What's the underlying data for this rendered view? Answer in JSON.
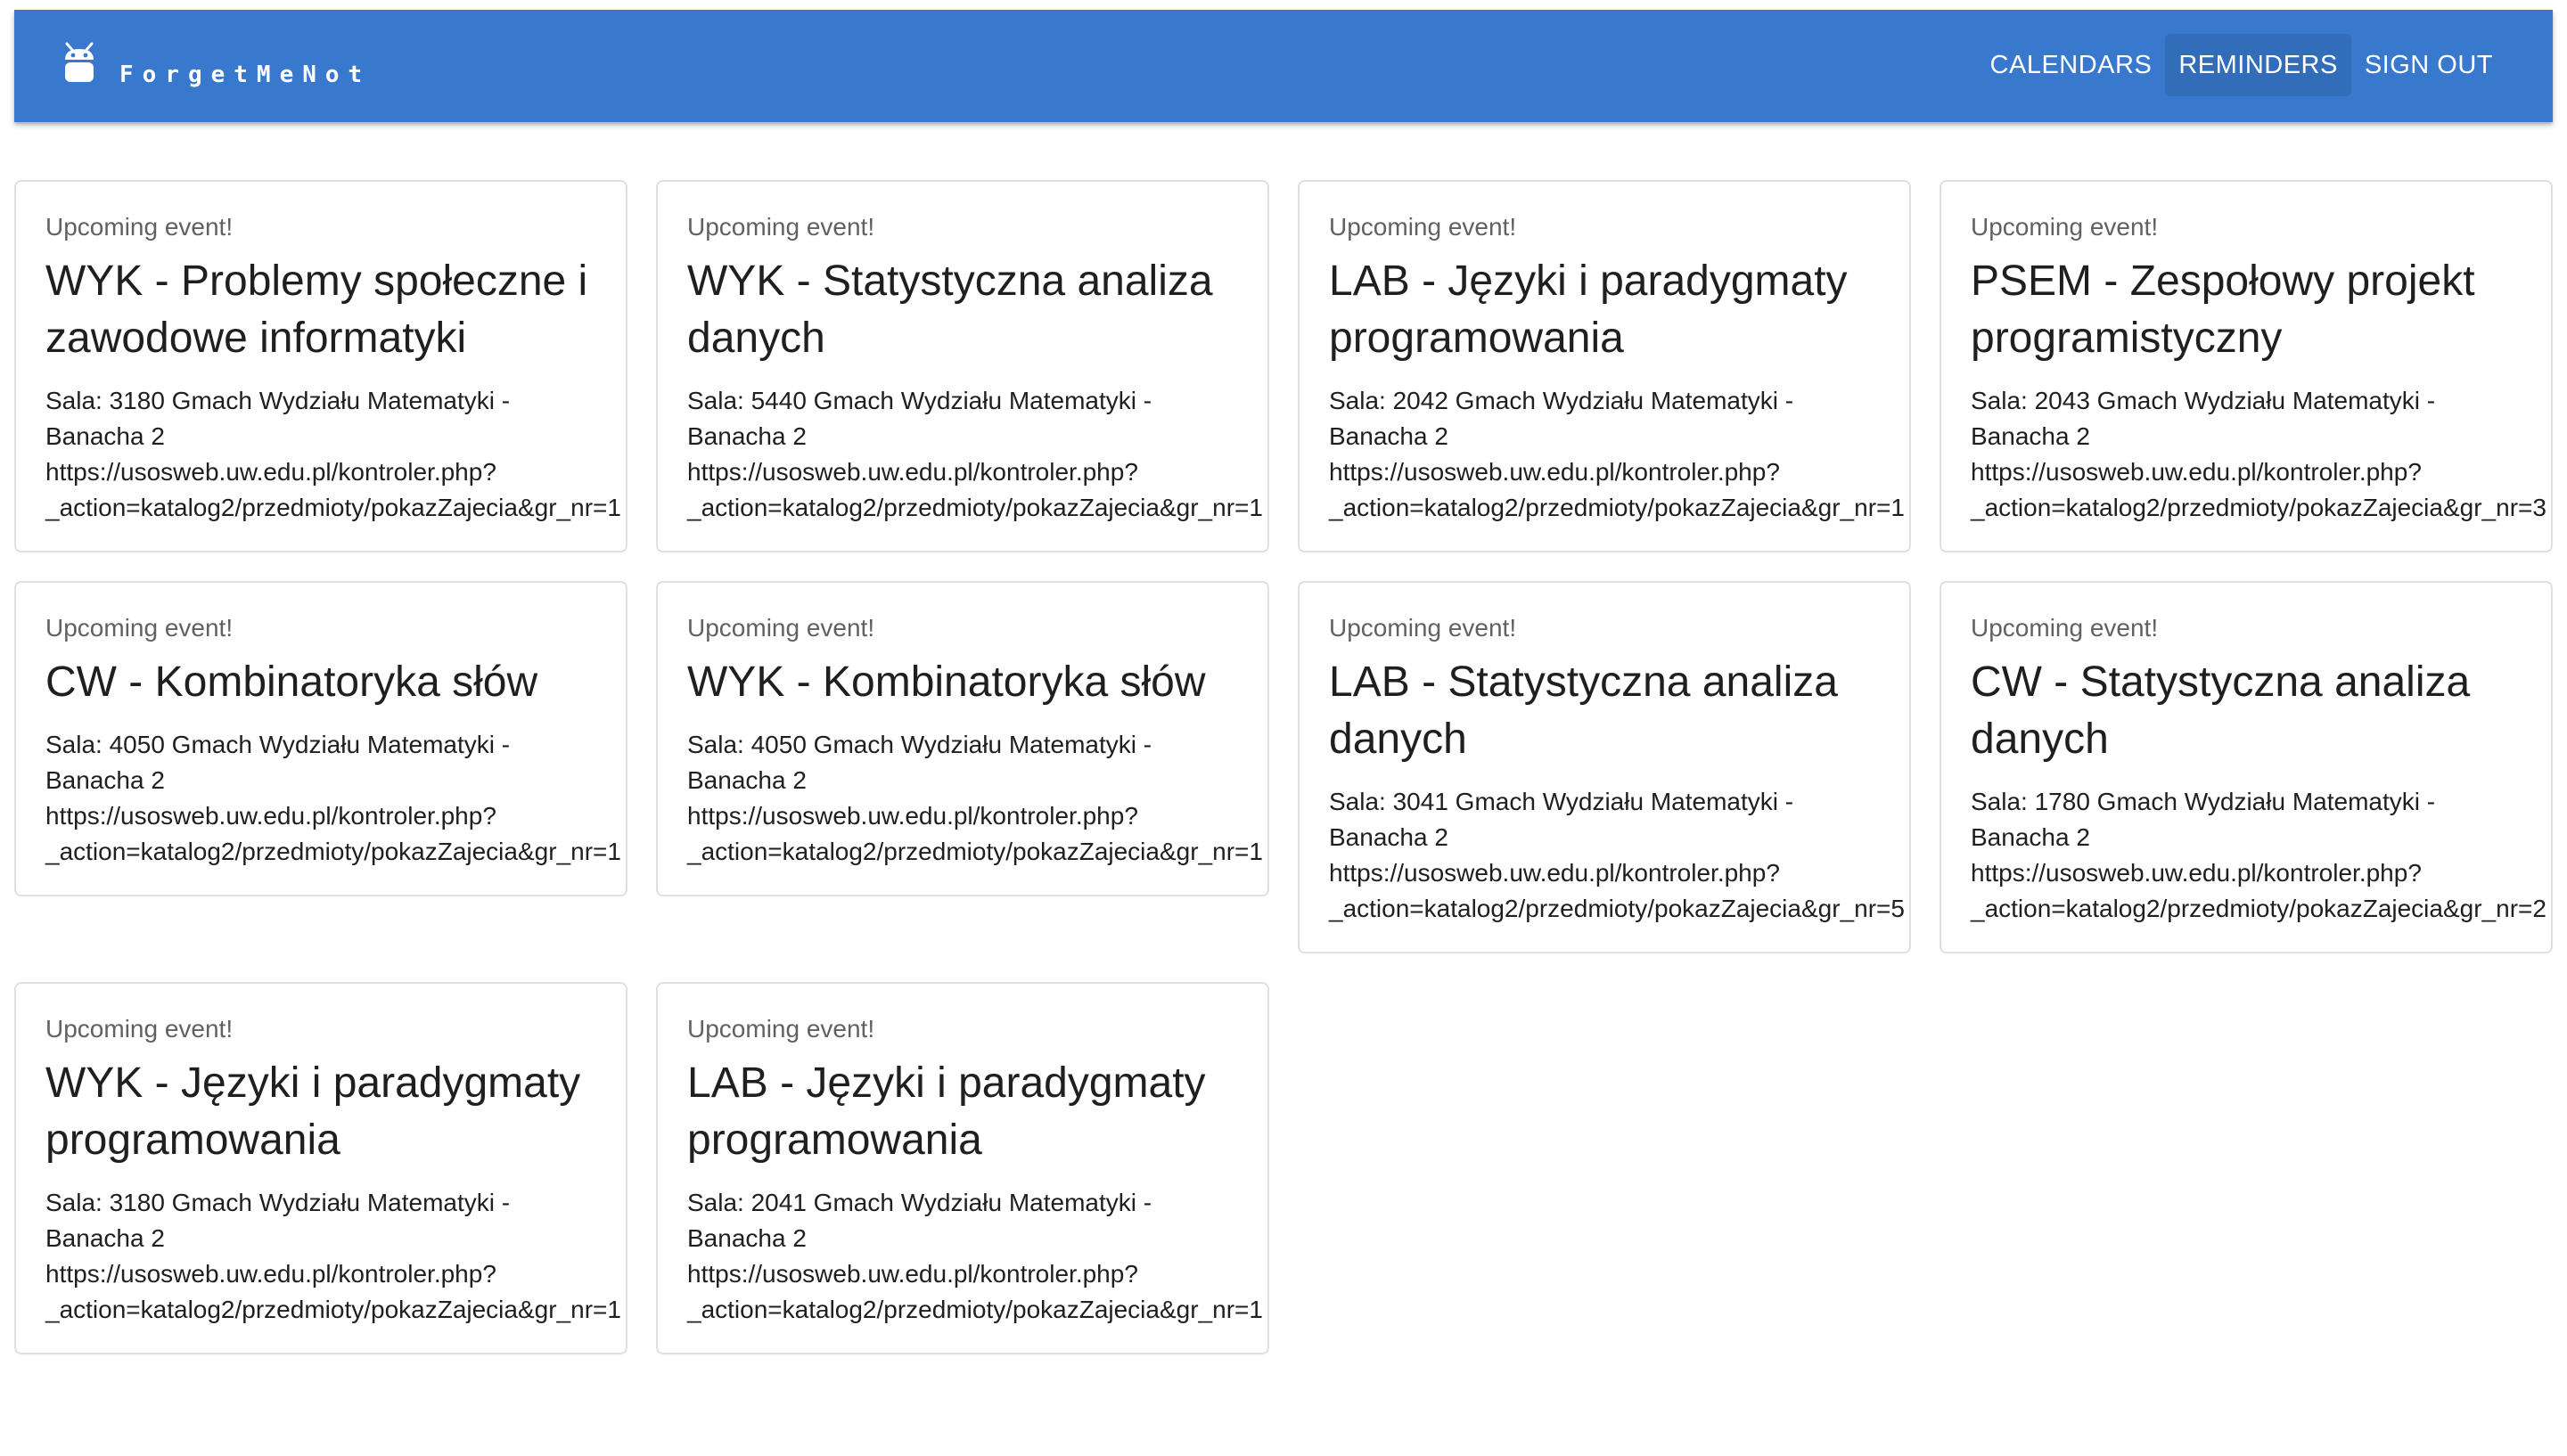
{
  "app": {
    "name": "ForgetMeNot",
    "logo_icon": "robot-icon",
    "accent": "#3878cd"
  },
  "nav": {
    "calendars": "CALENDARS",
    "reminders": "REMINDERS",
    "sign_out": "SIGN OUT"
  },
  "cards": [
    {
      "overline": "Upcoming event!",
      "title": "WYK - Problemy społeczne i zawodowe informatyki",
      "room_line1": "Sala: 3180 Gmach Wydziału Matematyki -",
      "room_line2": "Banacha 2",
      "url_line1": "https://usosweb.uw.edu.pl/kontroler.php?",
      "url_line2": "_action=katalog2/przedmioty/pokazZajecia&gr_nr=1"
    },
    {
      "overline": "Upcoming event!",
      "title": "WYK - Statystyczna analiza danych",
      "room_line1": "Sala: 5440 Gmach Wydziału Matematyki -",
      "room_line2": "Banacha 2",
      "url_line1": "https://usosweb.uw.edu.pl/kontroler.php?",
      "url_line2": "_action=katalog2/przedmioty/pokazZajecia&gr_nr=1"
    },
    {
      "overline": "Upcoming event!",
      "title": "LAB - Języki i paradygmaty programowania",
      "room_line1": "Sala: 2042 Gmach Wydziału Matematyki -",
      "room_line2": "Banacha 2",
      "url_line1": "https://usosweb.uw.edu.pl/kontroler.php?",
      "url_line2": "_action=katalog2/przedmioty/pokazZajecia&gr_nr=1"
    },
    {
      "overline": "Upcoming event!",
      "title": "PSEM - Zespołowy projekt programistyczny",
      "room_line1": "Sala: 2043 Gmach Wydziału Matematyki -",
      "room_line2": "Banacha 2",
      "url_line1": "https://usosweb.uw.edu.pl/kontroler.php?",
      "url_line2": "_action=katalog2/przedmioty/pokazZajecia&gr_nr=3"
    },
    {
      "overline": "Upcoming event!",
      "title": "CW - Kombinatoryka słów",
      "room_line1": "Sala: 4050 Gmach Wydziału Matematyki -",
      "room_line2": "Banacha 2",
      "url_line1": "https://usosweb.uw.edu.pl/kontroler.php?",
      "url_line2": "_action=katalog2/przedmioty/pokazZajecia&gr_nr=1"
    },
    {
      "overline": "Upcoming event!",
      "title": "WYK - Kombinatoryka słów",
      "room_line1": "Sala: 4050 Gmach Wydziału Matematyki -",
      "room_line2": "Banacha 2",
      "url_line1": "https://usosweb.uw.edu.pl/kontroler.php?",
      "url_line2": "_action=katalog2/przedmioty/pokazZajecia&gr_nr=1"
    },
    {
      "overline": "Upcoming event!",
      "title": "LAB - Statystyczna analiza danych",
      "room_line1": "Sala: 3041 Gmach Wydziału Matematyki -",
      "room_line2": "Banacha 2",
      "url_line1": "https://usosweb.uw.edu.pl/kontroler.php?",
      "url_line2": "_action=katalog2/przedmioty/pokazZajecia&gr_nr=5"
    },
    {
      "overline": "Upcoming event!",
      "title": "CW - Statystyczna analiza danych",
      "room_line1": "Sala: 1780 Gmach Wydziału Matematyki -",
      "room_line2": "Banacha 2",
      "url_line1": "https://usosweb.uw.edu.pl/kontroler.php?",
      "url_line2": "_action=katalog2/przedmioty/pokazZajecia&gr_nr=2"
    },
    {
      "overline": "Upcoming event!",
      "title": "WYK - Języki i paradygmaty programowania",
      "room_line1": "Sala: 3180 Gmach Wydziału Matematyki -",
      "room_line2": "Banacha 2",
      "url_line1": "https://usosweb.uw.edu.pl/kontroler.php?",
      "url_line2": "_action=katalog2/przedmioty/pokazZajecia&gr_nr=1"
    },
    {
      "overline": "Upcoming event!",
      "title": "LAB - Języki i paradygmaty programowania",
      "room_line1": "Sala: 2041 Gmach Wydziału Matematyki -",
      "room_line2": "Banacha 2",
      "url_line1": "https://usosweb.uw.edu.pl/kontroler.php?",
      "url_line2": "_action=katalog2/przedmioty/pokazZajecia&gr_nr=1"
    }
  ]
}
